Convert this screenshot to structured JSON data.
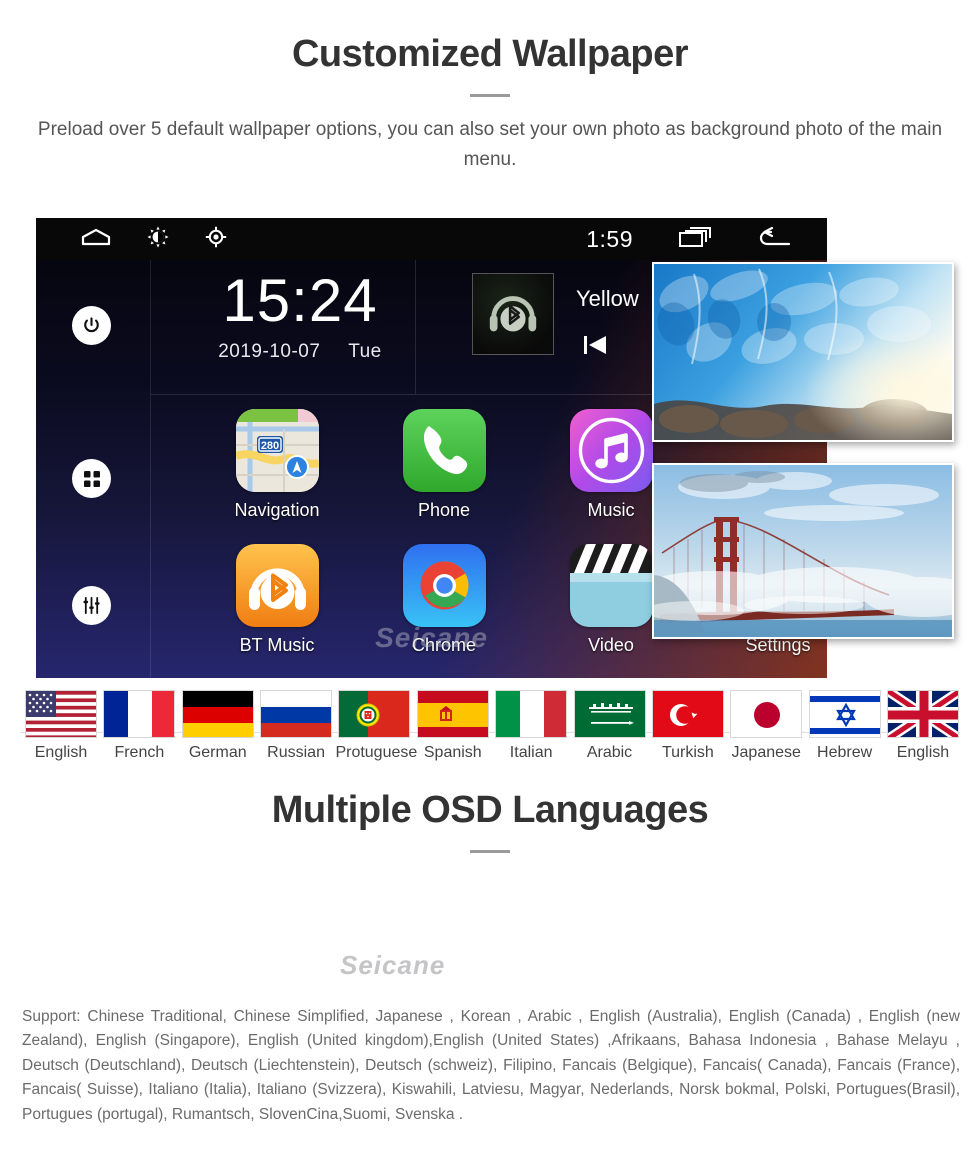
{
  "section_wallpaper": {
    "title": "Customized Wallpaper",
    "subtitle": "Preload over 5 default wallpaper options, you can also set your own photo as background photo of the main menu."
  },
  "head_unit": {
    "status_bar": {
      "home_icon": "home-icon",
      "brightness_icon": "brightness-icon",
      "gps_icon": "gps-target-icon",
      "clock": "1:59",
      "recents_icon": "recent-apps-icon",
      "back_icon": "back-arrow-icon"
    },
    "left_rail": [
      {
        "name": "power-button",
        "icon": "power-icon"
      },
      {
        "name": "apps-button",
        "icon": "grid-apps-icon"
      },
      {
        "name": "equalizer-button",
        "icon": "equalizer-sliders-icon"
      }
    ],
    "clock_widget": {
      "time": "15:24",
      "date": "2019-10-07",
      "weekday": "Tue"
    },
    "media_widget": {
      "album_icon": "bluetooth-headphones-icon",
      "track_title": "Yellow",
      "prev_icon": "previous-track-icon"
    },
    "apps": [
      {
        "label": "Navigation",
        "icon": "maps-icon",
        "badge": "280"
      },
      {
        "label": "Phone",
        "icon": "phone-icon",
        "badge": ""
      },
      {
        "label": "Music",
        "icon": "music-note-icon",
        "badge": ""
      },
      {
        "label": "BT Music",
        "icon": "bluetooth-music-icon",
        "badge": ""
      },
      {
        "label": "Chrome",
        "icon": "chrome-icon",
        "badge": ""
      },
      {
        "label": "Video",
        "icon": "video-clapper-icon",
        "badge": ""
      },
      {
        "label": "Settings",
        "icon": "settings-icon",
        "badge": ""
      }
    ],
    "watermark": "Seicane"
  },
  "wallpaper_thumbnails": [
    {
      "name": "ice-cave-wallpaper",
      "description": "Blue ice cave"
    },
    {
      "name": "golden-gate-wallpaper",
      "description": "Golden Gate Bridge in fog"
    }
  ],
  "section_languages": {
    "title": "Multiple OSD Languages",
    "watermark": "Seicane",
    "flags": [
      {
        "label": "English",
        "flag": "flag-us"
      },
      {
        "label": "French",
        "flag": "flag-fr"
      },
      {
        "label": "German",
        "flag": "flag-de"
      },
      {
        "label": "Russian",
        "flag": "flag-ru"
      },
      {
        "label": "Protuguese",
        "flag": "flag-pt"
      },
      {
        "label": "Spanish",
        "flag": "flag-es"
      },
      {
        "label": "Italian",
        "flag": "flag-it"
      },
      {
        "label": "Arabic",
        "flag": "flag-sa"
      },
      {
        "label": "Turkish",
        "flag": "flag-tr"
      },
      {
        "label": "Japanese",
        "flag": "flag-jp"
      },
      {
        "label": "Hebrew",
        "flag": "flag-il"
      },
      {
        "label": "English",
        "flag": "flag-gb"
      }
    ],
    "support_text": "Support: Chinese Traditional, Chinese Simplified, Japanese , Korean , Arabic , English (Australia), English (Canada) , English (new Zealand), English (Singapore), English (United kingdom),English (United States) ,Afrikaans, Bahasa Indonesia , Bahase Melayu , Deutsch (Deutschland), Deutsch (Liechtenstein), Deutsch (schweiz), Filipino, Fancais (Belgique), Fancais( Canada), Fancais (France), Fancais( Suisse), Italiano (Italia), Italiano (Svizzera), Kiswahili, Latviesu, Magyar, Nederlands, Norsk bokmal, Polski, Portugues(Brasil), Portugues (portugal), Rumantsch, SlovenCina,Suomi, Svenska ."
  },
  "colors": {
    "heading": "#333333",
    "body_text": "#555555",
    "support_text": "#6b6b6b",
    "screen_bg_top": "#060610",
    "screen_bg_bottom": "#26266e"
  }
}
